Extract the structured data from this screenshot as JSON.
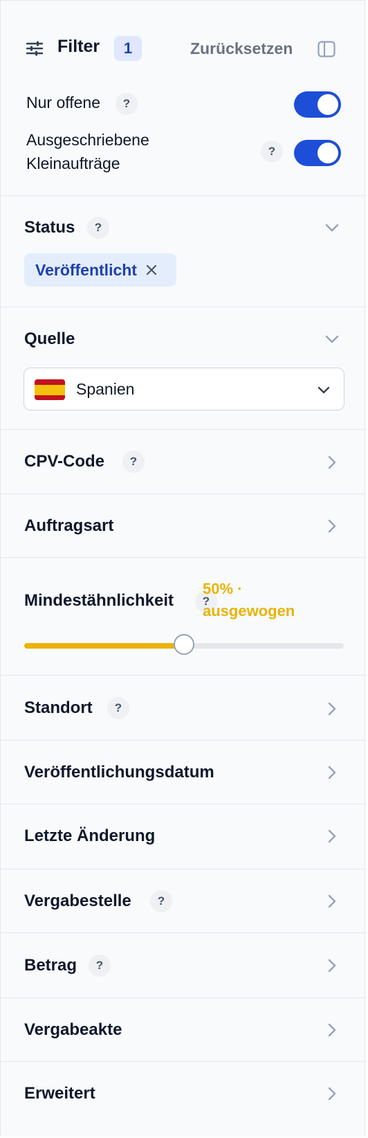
{
  "header": {
    "title": "Filter",
    "active_count": "1",
    "reset_label": "Zurücksetzen",
    "filter_icon": "sliders-icon",
    "panel_toggle_icon": "sidebar-panel-icon"
  },
  "toggles": [
    {
      "label": "Nur offene",
      "help": "?",
      "on": true
    },
    {
      "label_line1": "Ausgeschriebene",
      "label_line2": "Kleinaufträge",
      "help": "?",
      "on": true
    }
  ],
  "status": {
    "title": "Status",
    "help": "?",
    "chip_label": "Veröffentlicht",
    "expanded": true
  },
  "source": {
    "title": "Quelle",
    "selected": "Spanien",
    "flag": "spain-flag-icon",
    "expanded": true
  },
  "similarity": {
    "title": "Mindestähnlichkeit",
    "help": "?",
    "value_line1": "50% ·",
    "value_line2": "ausgewogen",
    "percent": 50
  },
  "sections": [
    {
      "title": "CPV-Code",
      "help": "?"
    },
    {
      "title": "Auftragsart"
    },
    {
      "title": "Standort",
      "help": "?"
    },
    {
      "title": "Veröffentlichungsdatum"
    },
    {
      "title": "Letzte Änderung"
    },
    {
      "title": "Vergabestelle",
      "help": "?"
    },
    {
      "title": "Betrag",
      "help": "?"
    },
    {
      "title": "Vergabeakte"
    },
    {
      "title": "Erweitert"
    }
  ],
  "colors": {
    "accent_blue": "#1d4ed8",
    "chip_text": "#1e40af",
    "similarity": "#eab308"
  }
}
